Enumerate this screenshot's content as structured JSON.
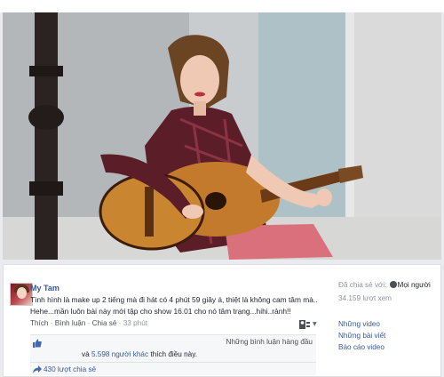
{
  "post": {
    "author": "My Tam",
    "caption_line1": "Tình hình là make up 2 tiếng mà đi hát có 4 phút 59 giây á, thiệt là không cam tâm mà..",
    "caption_line2": "Hehe...mần luôn bài này mới tập cho show 16.01 cho nó tâm trạng...hihi..rảnh!!"
  },
  "actions": {
    "like": "Thích",
    "comment": "Bình luận",
    "share": "Chia sẻ",
    "time": "33 phút",
    "separator": " · "
  },
  "likes": {
    "comment_order": "Những bình luận hàng đầu",
    "prefix": "và",
    "count": "5.598 người khác",
    "suffix": "thích điều này."
  },
  "shares": {
    "text": "430 lượt chia sẻ"
  },
  "sidebar": {
    "shared_with_label": "Đã chia sẻ với:",
    "audience": "Mọi người",
    "views": "34.159 lượt xem",
    "links": [
      "Những video",
      "Những bài viết",
      "Báo cáo video"
    ]
  },
  "icons": {
    "like": "like-thumb-icon",
    "share": "share-arrow-icon",
    "globe": "globe-icon",
    "sort": "comment-sort-icon"
  },
  "colors": {
    "link": "#365899",
    "muted": "#90949c",
    "background": "#e9ebee"
  }
}
